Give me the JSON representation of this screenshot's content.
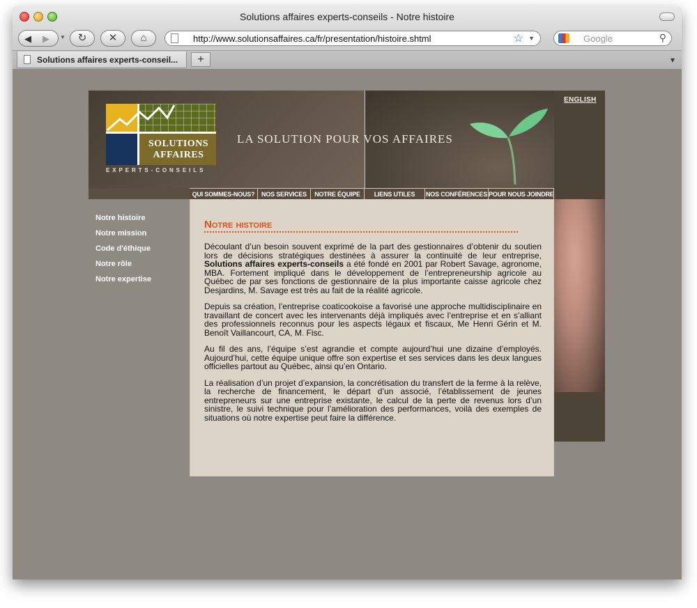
{
  "window": {
    "title": "Solutions affaires experts-conseils - Notre histoire"
  },
  "toolbar": {
    "url": "http://www.solutionsaffaires.ca/fr/presentation/histoire.shtml",
    "search_placeholder": "Google"
  },
  "tabs": [
    {
      "label": "Solutions affaires experts-conseil..."
    }
  ],
  "site": {
    "english_link": "ENGLISH",
    "tagline": "LA SOLUTION POUR VOS AFFAIRES",
    "logo": {
      "line1": "SOLUTIONS",
      "line2": "AFFAIRES",
      "sub": "EXPERTS-CONSEILS"
    },
    "nav": [
      "QUI SOMMES-NOUS?",
      "NOS SERVICES",
      "NOTRE ÉQUIPE",
      "LIENS UTILES",
      "NOS CONFÉRENCES",
      "POUR NOUS JOINDRE"
    ],
    "sidebar": [
      "Notre histoire",
      "Notre mission",
      "Code d'éthique",
      "Notre rôle",
      "Notre expertise"
    ],
    "content": {
      "title": "Notre histoire",
      "p1_a": "Découlant d’un besoin souvent exprimé de la part des gestionnaires d’obtenir du soutien lors de décisions stratégiques destinées à assurer la continuité de leur entreprise, ",
      "p1_bold": "Solutions affaires experts-conseils",
      "p1_b": " a été fondé en 2001 par Robert Savage, agronome, MBA. Fortement impliqué dans le développement de l’entrepreneurship agricole au Québec de par ses fonctions de gestionnaire de la plus importante caisse agricole chez Desjardins, M. Savage est très au fait de la réalité agricole.",
      "p2": "Depuis sa création, l’entreprise coaticookoise a favorisé une approche multidisciplinaire en travaillant de concert avec les intervenants déjà impliqués avec l’entreprise et en s’alliant des professionnels reconnus pour les aspects légaux et fiscaux, Me Henri Gérin et M. Benoît Vaillancourt, CA, M. Fisc.",
      "p3": "Au fil des ans, l’équipe s’est agrandie et compte aujourd’hui une dizaine d’employés. Aujourd’hui, cette équipe unique offre son expertise et ses services dans les deux langues officielles partout au Québec, ainsi qu’en Ontario.",
      "p4": "La réalisation d’un projet d’expansion, la concrétisation du transfert de la ferme à la relève, la recherche de financement, le départ d’un associé, l’établissement de jeunes entrepreneurs sur une entreprise existante, le calcul de la perte de revenus lors d’un sinistre, le suivi technique pour l’amélioration des performances, voilà des exemples de situations où notre expertise peut faire la différence."
    }
  },
  "colors": {
    "accent": "#d8541e",
    "page_bg": "#8f8983",
    "content_bg": "#dcd4c8",
    "header_bg": "#5a4f43"
  }
}
